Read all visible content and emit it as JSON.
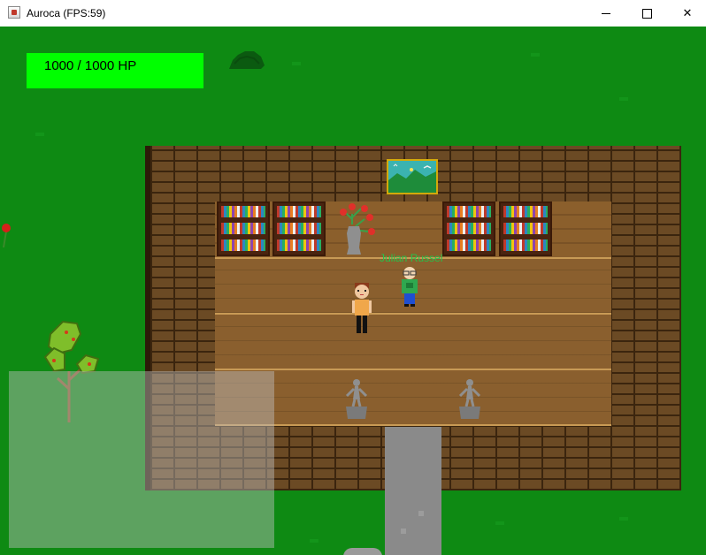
{
  "window": {
    "title": "Auroca (FPS:59)",
    "minimize_glyph": "minimize-icon",
    "maximize_glyph": "maximize-icon",
    "close_glyph": "✕"
  },
  "hud": {
    "hp_text": "1000 / 1000 HP",
    "hp_fraction": 1.0,
    "hp_color": "#00ff00"
  },
  "npc": {
    "name": "Julian Russel",
    "label_color": "#23c44b"
  },
  "colors": {
    "grass": "#0e8a13",
    "wall_brick": "#6b4a24",
    "floor_wood": "#8a5f2e",
    "path_stone": "#8a8a8a",
    "painting_frame": "#d4a90a"
  }
}
